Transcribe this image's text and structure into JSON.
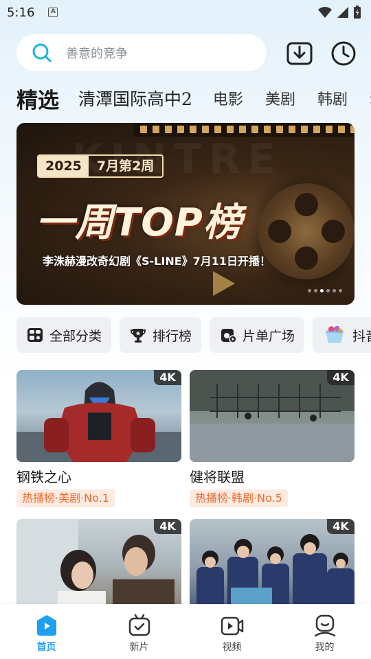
{
  "status_bar": {
    "time": "5:16",
    "notification_badge": "A"
  },
  "search": {
    "placeholder": "善意的竞争"
  },
  "header_icons": {
    "download": "download-icon",
    "history": "history-clock-icon"
  },
  "tabs": [
    {
      "label": "精选",
      "active": true
    },
    {
      "label": "清潭国际高中2",
      "active": false
    },
    {
      "label": "电影",
      "active": false
    },
    {
      "label": "美剧",
      "active": false
    },
    {
      "label": "韩剧",
      "active": false
    },
    {
      "label": "动",
      "active": false
    }
  ],
  "banner": {
    "year": "2025",
    "week": "7月第2周",
    "headline": "一周TOP榜",
    "subline": "李洙赫漫改奇幻剧《S-LINE》7月11日开播！",
    "bg_letters": "KINTRE",
    "slide_count": 6,
    "active_slide": 3
  },
  "categories": [
    {
      "label": "全部分类",
      "icon": "grid-category-icon"
    },
    {
      "label": "排行榜",
      "icon": "trophy-icon"
    },
    {
      "label": "片单广场",
      "icon": "playlist-icon"
    },
    {
      "label": "抖音",
      "icon": "shopping-basket-icon"
    }
  ],
  "cards": [
    {
      "title": "钢铁之心",
      "badge": "4K",
      "rank": "热播榜·美剧·No.1"
    },
    {
      "title": "健将联盟",
      "badge": "4K",
      "rank": "热播榜·韩剧·No.5"
    },
    {
      "title": "",
      "badge": "4K",
      "rank": ""
    },
    {
      "title": "",
      "badge": "4K",
      "rank": ""
    }
  ],
  "bottom_nav": [
    {
      "label": "首页",
      "icon": "home-play-icon",
      "active": true
    },
    {
      "label": "新片",
      "icon": "new-release-tv-icon",
      "active": false
    },
    {
      "label": "视频",
      "icon": "video-camera-icon",
      "active": false
    },
    {
      "label": "我的",
      "icon": "profile-icon",
      "active": false
    }
  ],
  "colors": {
    "accent": "#1ea0f0",
    "rank_text": "#f06a2d",
    "rank_bg": "#fdebe2"
  }
}
